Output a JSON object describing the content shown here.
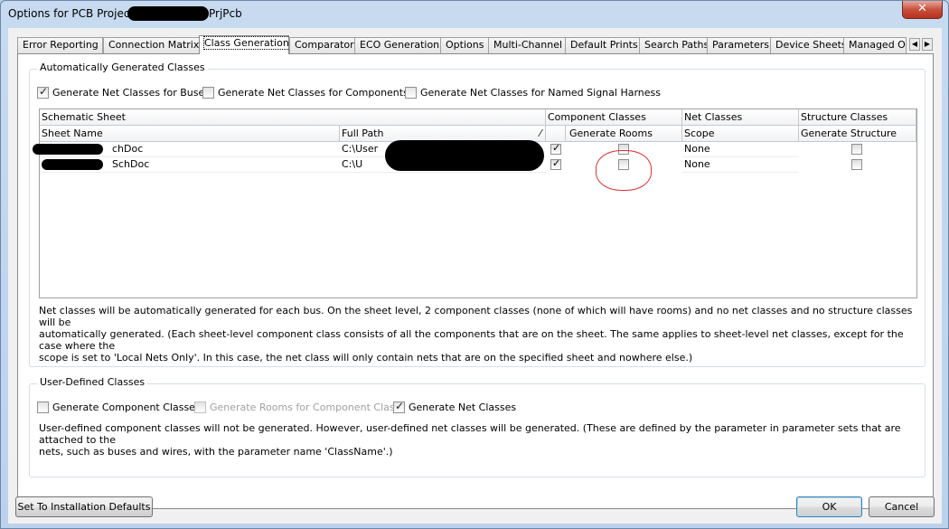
{
  "window": {
    "title_prefix": "Options for PCB Projec",
    "title_suffix": "PrjPcb",
    "close_label": "✕"
  },
  "tabs": [
    {
      "label": "Error Reporting",
      "active": false
    },
    {
      "label": "Connection Matrix",
      "active": false
    },
    {
      "label": "Class Generation",
      "active": true
    },
    {
      "label": "Comparator",
      "active": false
    },
    {
      "label": "ECO Generation",
      "active": false
    },
    {
      "label": "Options",
      "active": false
    },
    {
      "label": "Multi-Channel",
      "active": false
    },
    {
      "label": "Default Prints",
      "active": false
    },
    {
      "label": "Search Paths",
      "active": false
    },
    {
      "label": "Parameters",
      "active": false
    },
    {
      "label": "Device Sheets",
      "active": false
    },
    {
      "label": "Managed O",
      "active": false
    }
  ],
  "auto": {
    "group_label": "Automatically Generated Classes",
    "gen_buses": {
      "label": "Generate Net Classes for Buses",
      "checked": true
    },
    "gen_components": {
      "label": "Generate Net Classes for Components",
      "checked": false
    },
    "gen_harness": {
      "label": "Generate Net Classes for Named Signal Harness",
      "checked": false
    },
    "headers": {
      "schematic_sheet": "Schematic Sheet",
      "component_classes": "Component Classes",
      "net_classes": "Net Classes",
      "structure_classes": "Structure Classes",
      "sheet_name": "Sheet Name",
      "full_path": "Full Path",
      "generate_rooms": "Generate Rooms",
      "scope": "Scope",
      "generate_structure": "Generate Structure"
    },
    "rows": [
      {
        "sheet_name": "chDoc",
        "full_path": "C:\\User",
        "component_checked": true,
        "rooms_checked": false,
        "scope": "None",
        "structure_checked": false
      },
      {
        "sheet_name": "SchDoc",
        "full_path": "C:\\U",
        "component_checked": true,
        "rooms_checked": false,
        "scope": "None",
        "structure_checked": false
      }
    ],
    "description_lines": [
      "Net classes will be automatically generated for each bus. On the sheet level, 2 component classes (none of which will have rooms) and no net classes and no structure classes will be",
      "automatically generated. (Each sheet-level component class consists of all the components that are on the sheet. The same applies to sheet-level net classes, except for the case where the",
      "scope is set to 'Local Nets Only'. In this case, the net class will only contain nets that are on the specified sheet and nowhere else.)"
    ]
  },
  "user": {
    "group_label": "User-Defined Classes",
    "gen_component_classes": {
      "label": "Generate Component Classes",
      "checked": false
    },
    "gen_rooms": {
      "label": "Generate Rooms for Component Class",
      "checked": false
    },
    "gen_net_classes": {
      "label": "Generate Net Classes",
      "checked": true
    },
    "description_lines": [
      "User-defined component classes will not be generated. However, user-defined net classes will be generated. (These are defined by the parameter in parameter sets that are attached to the",
      "nets, such as buses and wires, with the parameter name 'ClassName'.)"
    ]
  },
  "buttons": {
    "defaults": "Set To Installation Defaults",
    "ok": "OK",
    "cancel": "Cancel"
  },
  "colors": {
    "annotation_circle": "#e03030",
    "close_button": "#c7503c"
  }
}
